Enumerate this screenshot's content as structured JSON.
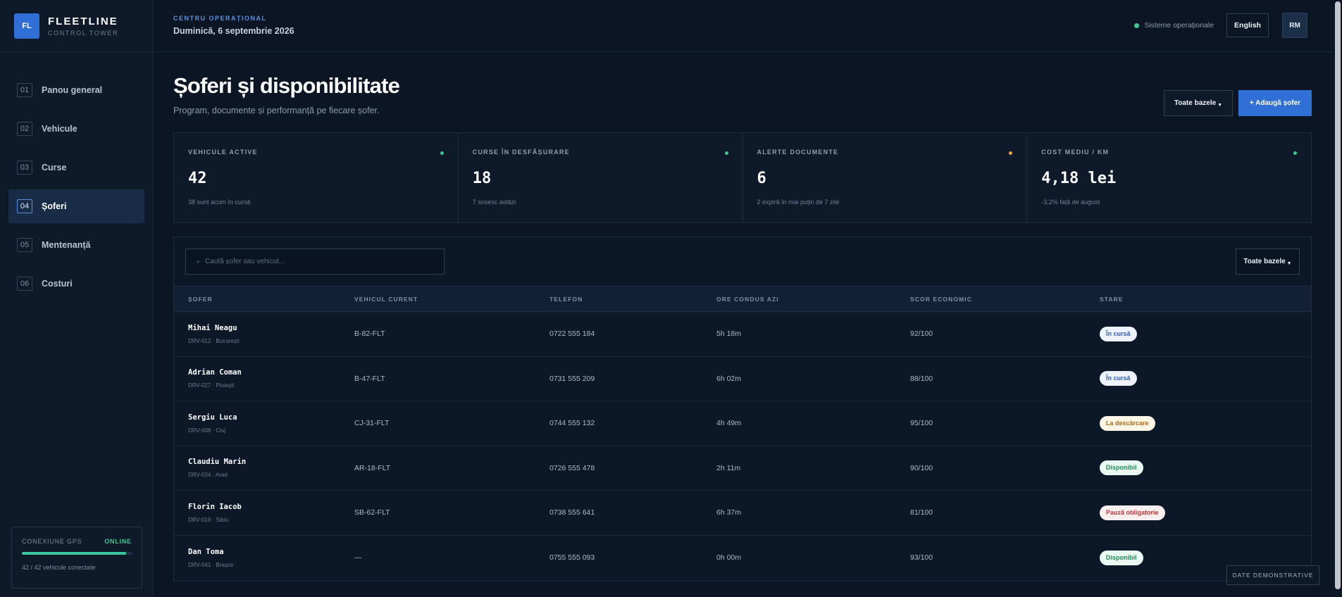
{
  "brand": {
    "logo": "FL",
    "name": "FLEETLINE",
    "subtitle": "CONTROL TOWER"
  },
  "header": {
    "eyebrow": "CENTRU OPERAȚIONAL",
    "date": "Duminică, 6 septembrie 2026",
    "system_status": "Sisteme operaționale",
    "language_button": "English",
    "avatar": "RM"
  },
  "sidebar": {
    "items": [
      {
        "num": "01",
        "label": "Panou general"
      },
      {
        "num": "02",
        "label": "Vehicule"
      },
      {
        "num": "03",
        "label": "Curse"
      },
      {
        "num": "04",
        "label": "Șoferi",
        "active": true
      },
      {
        "num": "05",
        "label": "Mentenanță"
      },
      {
        "num": "06",
        "label": "Costuri"
      }
    ],
    "gps": {
      "title": "CONEXIUNE GPS",
      "status": "ONLINE",
      "progress": 0.95,
      "caption": "42 / 42 vehicule conectate"
    }
  },
  "page": {
    "title": "Șoferi și disponibilitate",
    "subtitle": "Program, documente și performanță pe fiecare șofer.",
    "bases_button": "Toate bazele",
    "add_button": "+ Adaugă șofer"
  },
  "stats": [
    {
      "label": "VEHICULE ACTIVE",
      "value": "42",
      "note": "38 sunt acum în cursă",
      "dot_color": "#3bc992"
    },
    {
      "label": "CURSE ÎN DESFĂȘURARE",
      "value": "18",
      "note": "7 sosesc astăzi",
      "dot_color": "#3bc992"
    },
    {
      "label": "ALERTE DOCUMENTE",
      "value": "6",
      "note": "2 expiră în mai puțin de 7 zile",
      "dot_color": "#e8a74a"
    },
    {
      "label": "COST MEDIU / KM",
      "value": "4,18 lei",
      "note": "-3,2% față de august",
      "dot_color": "#3bc992"
    }
  ],
  "table": {
    "search_placeholder": "Caută șofer sau vehicul...",
    "filter_button": "Toate bazele",
    "columns": [
      "ȘOFER",
      "VEHICUL CURENT",
      "TELEFON",
      "ORE CONDUS AZI",
      "SCOR ECONOMIC",
      "STARE"
    ],
    "rows": [
      {
        "name": "Mihai Neagu",
        "id": "DRV-012 · București",
        "vehicle": "B-82-FLT",
        "phone": "0722 555 184",
        "hours": "5h 18m",
        "score": "92/100",
        "status": "În cursă",
        "status_kind": "blue"
      },
      {
        "name": "Adrian Coman",
        "id": "DRV-027 · Ploiești",
        "vehicle": "B-47-FLT",
        "phone": "0731 555 209",
        "hours": "6h 02m",
        "score": "88/100",
        "status": "În cursă",
        "status_kind": "blue"
      },
      {
        "name": "Sergiu Luca",
        "id": "DRV-008 · Cluj",
        "vehicle": "CJ-31-FLT",
        "phone": "0744 555 132",
        "hours": "4h 49m",
        "score": "95/100",
        "status": "La descărcare",
        "status_kind": "amber"
      },
      {
        "name": "Claudiu Marin",
        "id": "DRV-034 · Arad",
        "vehicle": "AR-18-FLT",
        "phone": "0726 555 478",
        "hours": "2h 11m",
        "score": "90/100",
        "status": "Disponibil",
        "status_kind": "green"
      },
      {
        "name": "Florin Iacob",
        "id": "DRV-019 · Sibiu",
        "vehicle": "SB-62-FLT",
        "phone": "0738 555 641",
        "hours": "6h 37m",
        "score": "81/100",
        "status": "Pauză obligatorie",
        "status_kind": "red"
      },
      {
        "name": "Dan Toma",
        "id": "DRV-041 · Brașov",
        "vehicle": "—",
        "phone": "0755 555 093",
        "hours": "0h 00m",
        "score": "93/100",
        "status": "Disponibil",
        "status_kind": "green"
      }
    ]
  },
  "badge_colors": {
    "blue": {
      "bg": "#eef3ff",
      "fg": "#2f5fc4"
    },
    "amber": {
      "bg": "#fff6e6",
      "fg": "#b46a16"
    },
    "green": {
      "bg": "#ebfaf2",
      "fg": "#1e8f5e"
    },
    "red": {
      "bg": "#fff0f0",
      "fg": "#c2363a"
    }
  },
  "demo_tag": "DATE DEMONSTRATIVE"
}
